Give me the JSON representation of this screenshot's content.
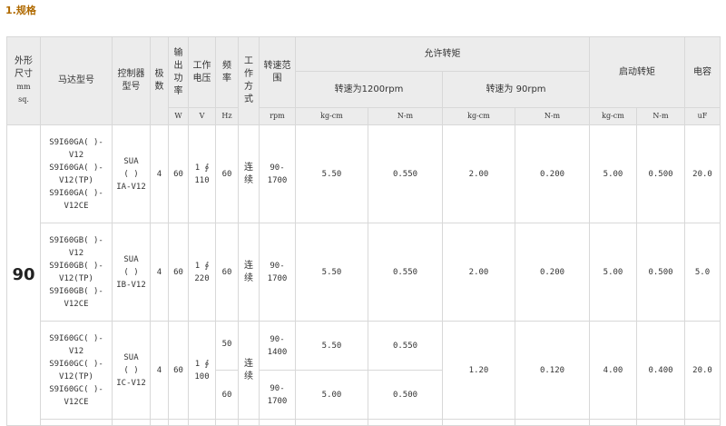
{
  "section_title": "1.规格",
  "headers": {
    "size": [
      "外形",
      "尺寸",
      "mm",
      "sq."
    ],
    "model": "马达型号",
    "controller": [
      "控制器",
      "型号"
    ],
    "poles": [
      "极",
      "数"
    ],
    "output": [
      "输",
      "出",
      "功",
      "率"
    ],
    "voltage": [
      "工作",
      "电压"
    ],
    "frequency": [
      "频",
      "率"
    ],
    "mode": [
      "工",
      "作",
      "方",
      "式"
    ],
    "speed_range": [
      "转速范",
      "围"
    ],
    "allowed_torque": "允许转矩",
    "speed_1200": "转速为1200rpm",
    "speed_90": "转速为 90rpm",
    "start_torque": "启动转矩",
    "capacitor": "电容"
  },
  "units": {
    "output": "W",
    "voltage": "V",
    "frequency": "Hz",
    "speed": "rpm",
    "t1200_kgcm": "kg-cm",
    "t1200_nm": "N-m",
    "t90_kgcm": "kg-cm",
    "t90_nm": "N-m",
    "start_kgcm": "kg-cm",
    "start_nm": "N-m",
    "capacitor": "uF"
  },
  "size_value": "90",
  "rows": [
    {
      "model_lines": [
        "S9I60GA( )-",
        "V12",
        "S9I60GA( )-",
        "V12(TP)",
        "S9I60GA( )-",
        "V12CE"
      ],
      "controller_lines": [
        "SUA",
        "( )",
        "IA-V12"
      ],
      "poles": "4",
      "output": "60",
      "voltage_lines": [
        "1 ∮",
        "110"
      ],
      "frequency": "60",
      "mode_lines": [
        "连",
        "续"
      ],
      "speed_lines": [
        "90-",
        "1700"
      ],
      "t1200_kgcm": "5.50",
      "t1200_nm": "0.550",
      "t90_kgcm": "2.00",
      "t90_nm": "0.200",
      "start_kgcm": "5.00",
      "start_nm": "0.500",
      "capacitor": "20.0"
    },
    {
      "model_lines": [
        "S9I60GB( )-",
        "V12",
        "S9I60GB( )-",
        "V12(TP)",
        "S9I60GB( )-",
        "V12CE"
      ],
      "controller_lines": [
        "SUA",
        "( )",
        "IB-V12"
      ],
      "poles": "4",
      "output": "60",
      "voltage_lines": [
        "1 ∮",
        "220"
      ],
      "frequency": "60",
      "mode_lines": [
        "连",
        "续"
      ],
      "speed_lines": [
        "90-",
        "1700"
      ],
      "t1200_kgcm": "5.50",
      "t1200_nm": "0.550",
      "t90_kgcm": "2.00",
      "t90_nm": "0.200",
      "start_kgcm": "5.00",
      "start_nm": "0.500",
      "capacitor": "5.0"
    },
    {
      "model_lines": [
        "S9I60GC( )-",
        "V12",
        "S9I60GC( )-",
        "V12(TP)",
        "S9I60GC( )-",
        "V12CE"
      ],
      "controller_lines": [
        "SUA",
        "( )",
        "IC-V12"
      ],
      "poles": "4",
      "output": "60",
      "voltage_lines": [
        "1 ∮",
        "100"
      ],
      "mode_lines": [
        "连",
        "续"
      ],
      "t90_kgcm": "1.20",
      "t90_nm": "0.120",
      "start_kgcm": "4.00",
      "start_nm": "0.400",
      "capacitor": "20.0",
      "sub": [
        {
          "frequency": "50",
          "speed_lines": [
            "90-",
            "1400"
          ],
          "t1200_kgcm": "5.50",
          "t1200_nm": "0.550"
        },
        {
          "frequency": "60",
          "speed_lines": [
            "90-",
            "1700"
          ],
          "t1200_kgcm": "5.00",
          "t1200_nm": "0.500"
        }
      ]
    }
  ]
}
